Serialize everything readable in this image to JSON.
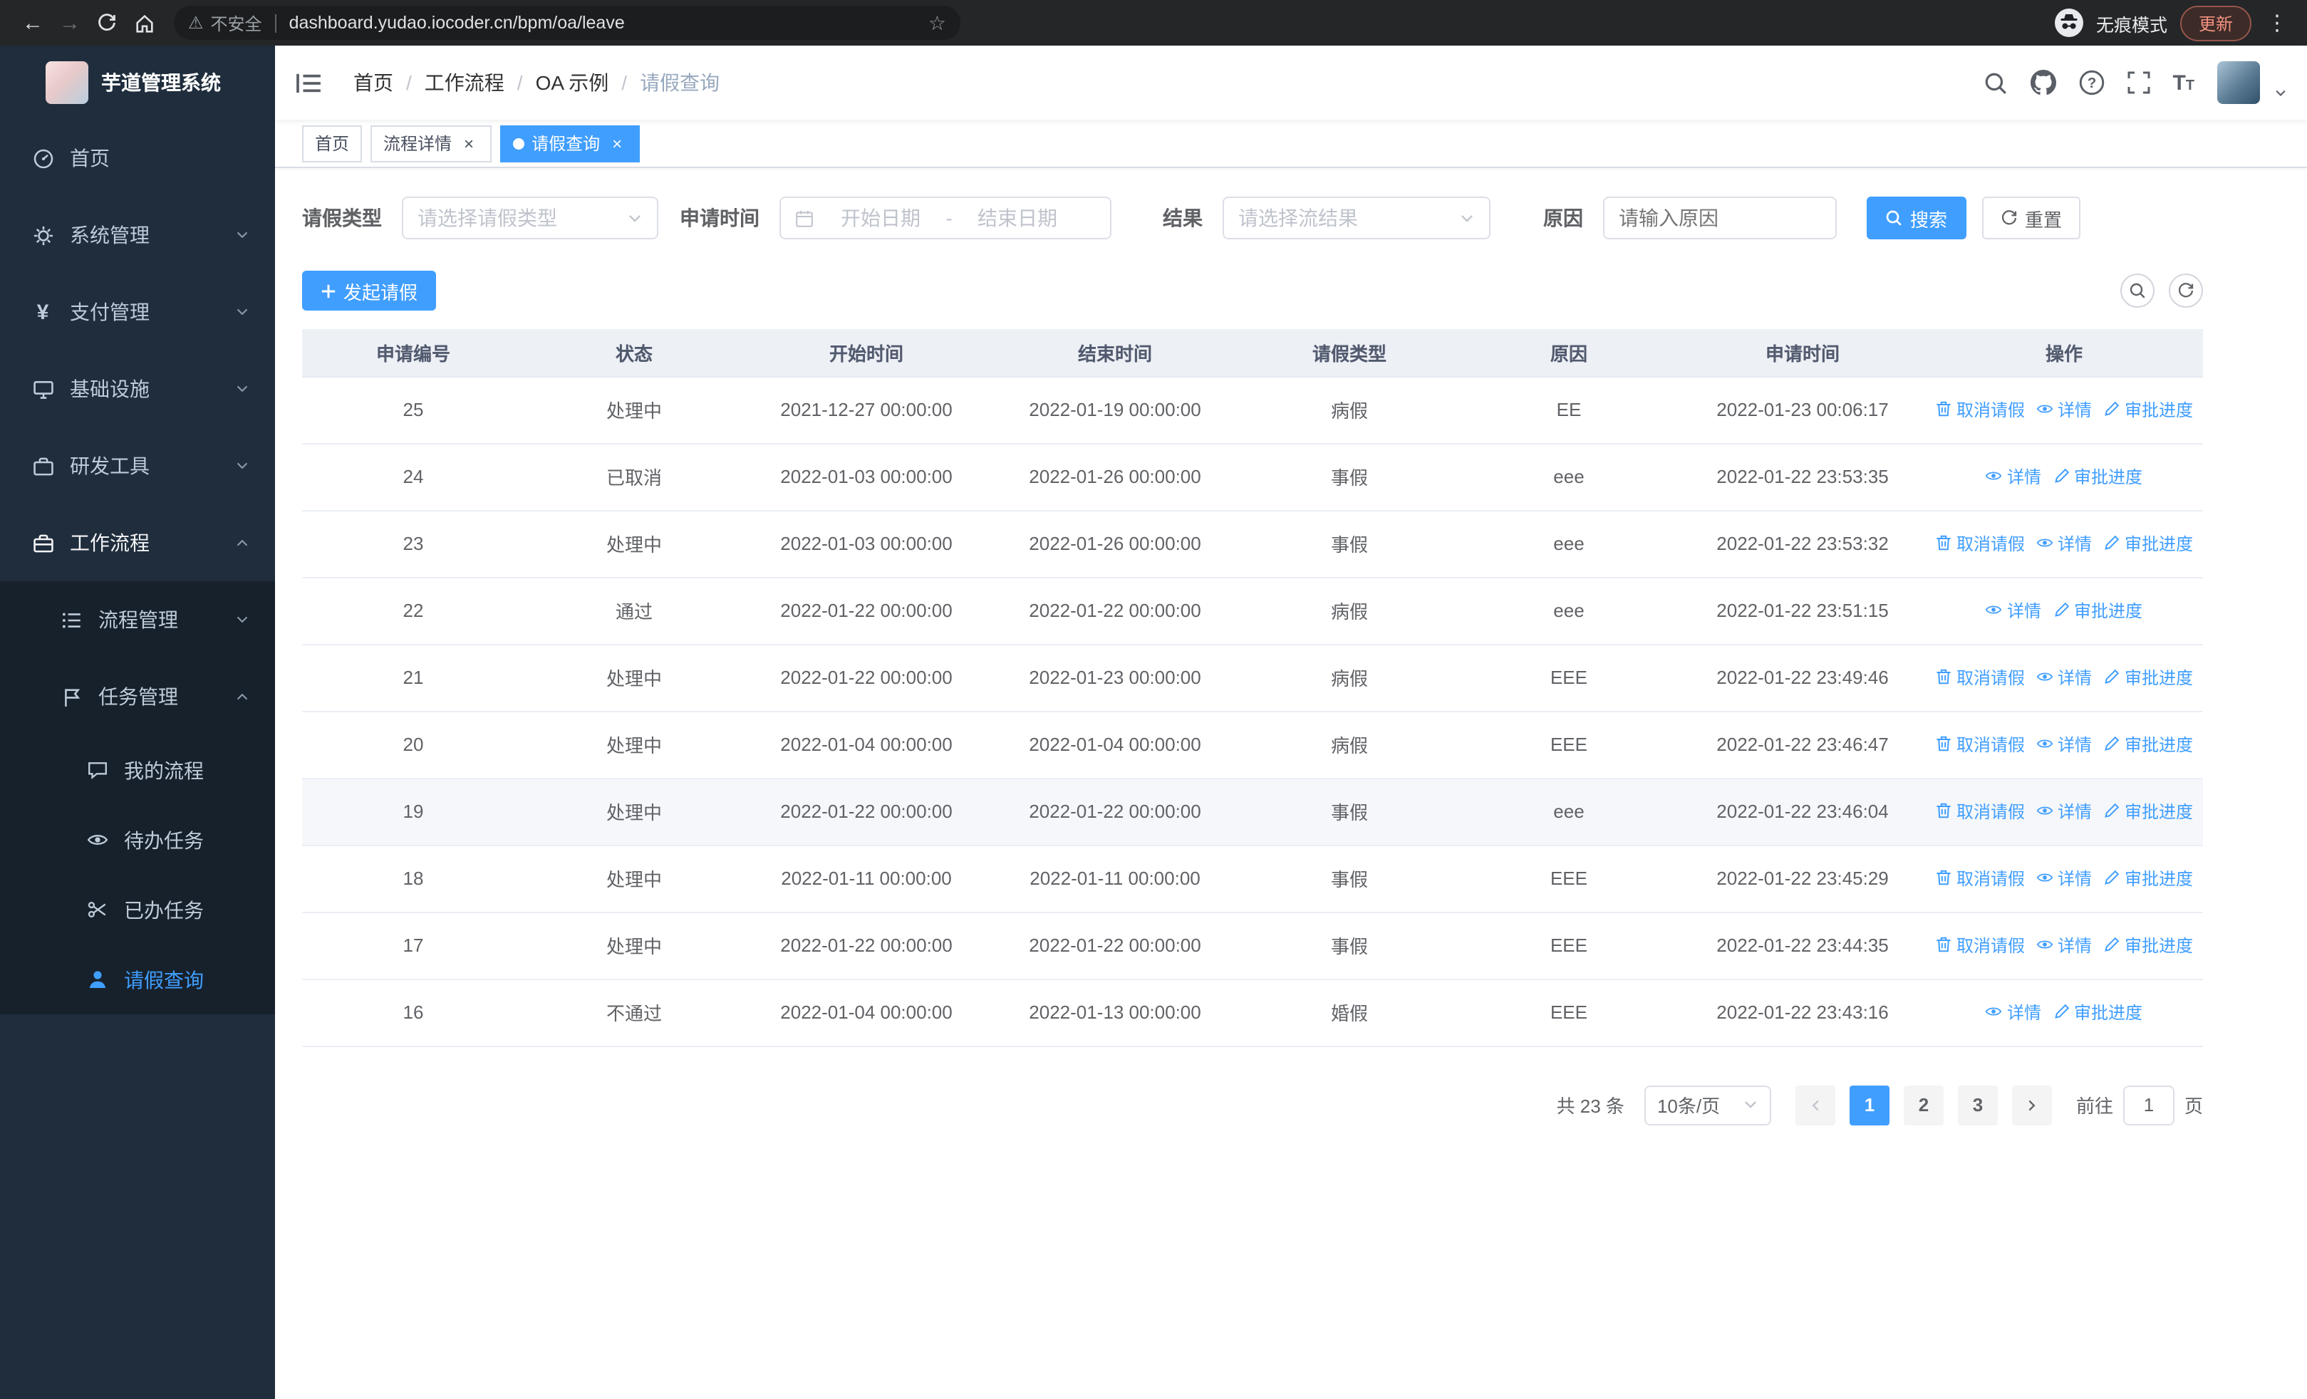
{
  "browser": {
    "security_label": "不安全",
    "url": "dashboard.yudao.iocoder.cn/bpm/oa/leave",
    "incognito_label": "无痕模式",
    "update_label": "更新"
  },
  "sidebar": {
    "logo_title": "芋道管理系统",
    "items": [
      {
        "label": "首页",
        "icon": "home-icon"
      },
      {
        "label": "系统管理",
        "icon": "gear-icon"
      },
      {
        "label": "支付管理",
        "icon": "payment-yen-icon"
      },
      {
        "label": "基础设施",
        "icon": "infrastructure-monitor-icon"
      },
      {
        "label": "研发工具",
        "icon": "devtools-briefcase-icon"
      },
      {
        "label": "工作流程",
        "icon": "workflow-briefcase-icon"
      },
      {
        "label": "流程管理",
        "icon": "process-list-icon"
      },
      {
        "label": "任务管理",
        "icon": "task-flag-icon"
      },
      {
        "label": "我的流程",
        "icon": "my-process-chat-icon"
      },
      {
        "label": "待办任务",
        "icon": "todo-eye-icon"
      },
      {
        "label": "已办任务",
        "icon": "done-scissors-icon"
      },
      {
        "label": "请假查询",
        "icon": "leave-user-icon"
      }
    ]
  },
  "header": {
    "breadcrumb": [
      "首页",
      "工作流程",
      "OA 示例",
      "请假查询"
    ],
    "breadcrumb_separator": "/"
  },
  "tabs": [
    {
      "label": "首页",
      "closable": false,
      "active": false
    },
    {
      "label": "流程详情",
      "closable": true,
      "active": false
    },
    {
      "label": "请假查询",
      "closable": true,
      "active": true
    }
  ],
  "filters": {
    "leave_type_label": "请假类型",
    "leave_type_placeholder": "请选择请假类型",
    "apply_time_label": "申请时间",
    "start_date_placeholder": "开始日期",
    "date_separator": "-",
    "end_date_placeholder": "结束日期",
    "result_label": "结果",
    "result_placeholder": "请选择流结果",
    "reason_label": "原因",
    "reason_placeholder": "请输入原因",
    "search_label": "搜索",
    "reset_label": "重置"
  },
  "toolbar": {
    "create_label": "发起请假"
  },
  "table": {
    "columns": [
      "申请编号",
      "状态",
      "开始时间",
      "结束时间",
      "请假类型",
      "原因",
      "申请时间",
      "操作"
    ],
    "action_labels": {
      "cancel": "取消请假",
      "detail": "详情",
      "progress": "审批进度"
    },
    "rows": [
      {
        "id": "25",
        "status": "处理中",
        "start": "2021-12-27 00:00:00",
        "end": "2022-01-19 00:00:00",
        "type": "病假",
        "reason": "EE",
        "applied": "2022-01-23 00:06:17",
        "actions": [
          "cancel",
          "detail",
          "progress"
        ]
      },
      {
        "id": "24",
        "status": "已取消",
        "start": "2022-01-03 00:00:00",
        "end": "2022-01-26 00:00:00",
        "type": "事假",
        "reason": "eee",
        "applied": "2022-01-22 23:53:35",
        "actions": [
          "detail",
          "progress"
        ]
      },
      {
        "id": "23",
        "status": "处理中",
        "start": "2022-01-03 00:00:00",
        "end": "2022-01-26 00:00:00",
        "type": "事假",
        "reason": "eee",
        "applied": "2022-01-22 23:53:32",
        "actions": [
          "cancel",
          "detail",
          "progress"
        ]
      },
      {
        "id": "22",
        "status": "通过",
        "start": "2022-01-22 00:00:00",
        "end": "2022-01-22 00:00:00",
        "type": "病假",
        "reason": "eee",
        "applied": "2022-01-22 23:51:15",
        "actions": [
          "detail",
          "progress"
        ]
      },
      {
        "id": "21",
        "status": "处理中",
        "start": "2022-01-22 00:00:00",
        "end": "2022-01-23 00:00:00",
        "type": "病假",
        "reason": "EEE",
        "applied": "2022-01-22 23:49:46",
        "actions": [
          "cancel",
          "detail",
          "progress"
        ]
      },
      {
        "id": "20",
        "status": "处理中",
        "start": "2022-01-04 00:00:00",
        "end": "2022-01-04 00:00:00",
        "type": "病假",
        "reason": "EEE",
        "applied": "2022-01-22 23:46:47",
        "actions": [
          "cancel",
          "detail",
          "progress"
        ]
      },
      {
        "id": "19",
        "status": "处理中",
        "start": "2022-01-22 00:00:00",
        "end": "2022-01-22 00:00:00",
        "type": "事假",
        "reason": "eee",
        "applied": "2022-01-22 23:46:04",
        "actions": [
          "cancel",
          "detail",
          "progress"
        ],
        "hovered": true
      },
      {
        "id": "18",
        "status": "处理中",
        "start": "2022-01-11 00:00:00",
        "end": "2022-01-11 00:00:00",
        "type": "事假",
        "reason": "EEE",
        "applied": "2022-01-22 23:45:29",
        "actions": [
          "cancel",
          "detail",
          "progress"
        ]
      },
      {
        "id": "17",
        "status": "处理中",
        "start": "2022-01-22 00:00:00",
        "end": "2022-01-22 00:00:00",
        "type": "事假",
        "reason": "EEE",
        "applied": "2022-01-22 23:44:35",
        "actions": [
          "cancel",
          "detail",
          "progress"
        ]
      },
      {
        "id": "16",
        "status": "不通过",
        "start": "2022-01-04 00:00:00",
        "end": "2022-01-13 00:00:00",
        "type": "婚假",
        "reason": "EEE",
        "applied": "2022-01-22 23:43:16",
        "actions": [
          "detail",
          "progress"
        ]
      }
    ]
  },
  "pagination": {
    "total_text": "共 23 条",
    "page_size_text": "10条/页",
    "pages": [
      "1",
      "2",
      "3"
    ],
    "active_page": "1",
    "goto_label": "前往",
    "goto_value": "1",
    "unit_label": "页"
  },
  "colors": {
    "accent": "#409eff",
    "sidebar_bg": "#1f2d3d",
    "submenu_bg": "#17212c",
    "table_header_bg": "#edf0f5",
    "hover_row_bg": "#f5f7fa"
  }
}
